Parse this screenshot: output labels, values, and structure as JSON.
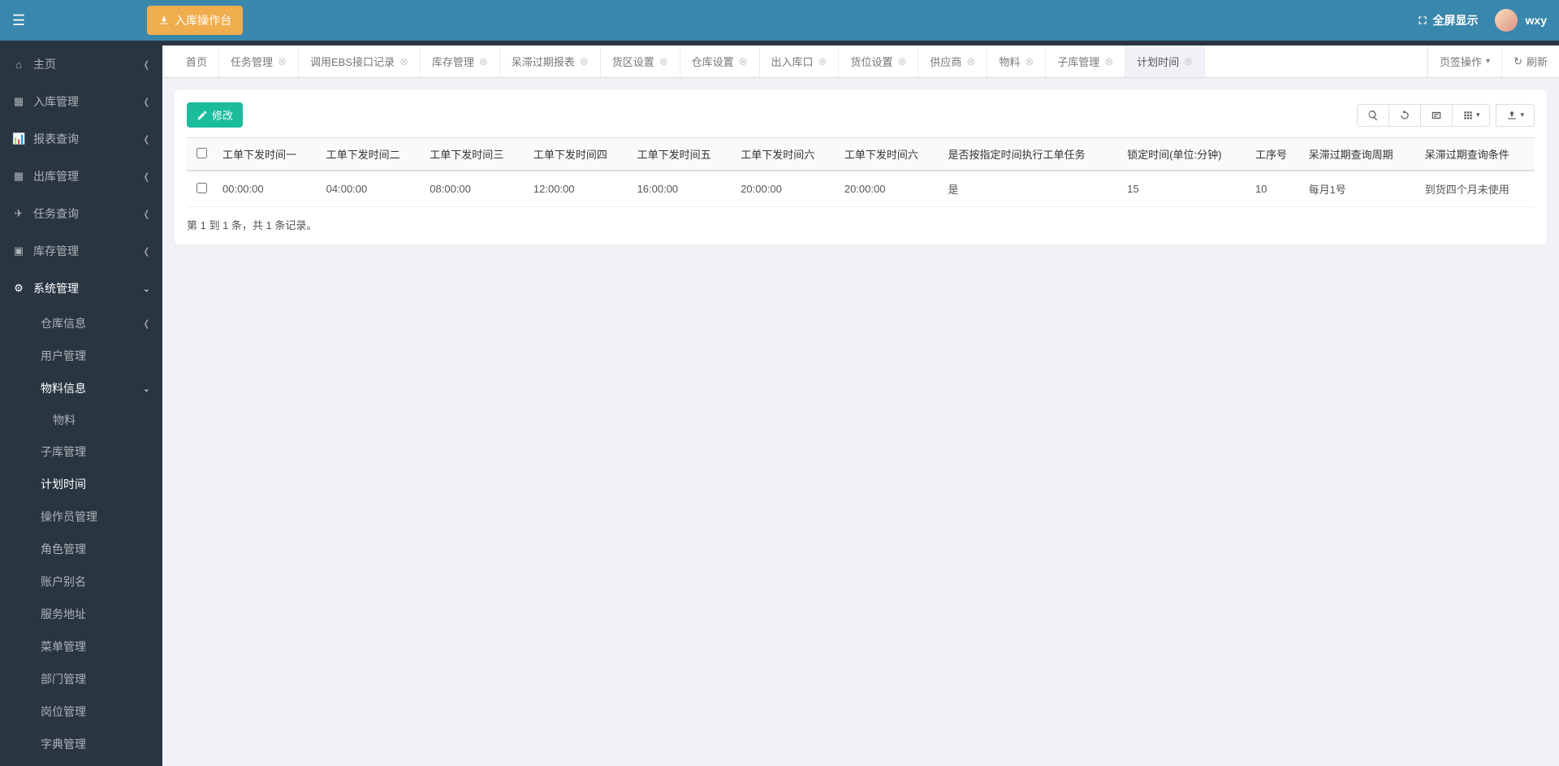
{
  "topbar": {
    "orange_button": "入库操作台",
    "fullscreen": "全屏显示",
    "username": "wxy"
  },
  "sidebar": {
    "home": "主页",
    "inbound": "入库管理",
    "report": "报表查询",
    "outbound": "出库管理",
    "task": "任务查询",
    "stock": "库存管理",
    "system": "系统管理",
    "sub": {
      "warehouse_info": "仓库信息",
      "user_mgmt": "用户管理",
      "material_info": "物料信息",
      "material": "物料",
      "subwarehouse": "子库管理",
      "schedule": "计划时间",
      "operator": "操作员管理",
      "role": "角色管理",
      "account_alias": "账户别名",
      "service_addr": "服务地址",
      "menu_mgmt": "菜单管理",
      "dept_mgmt": "部门管理",
      "position_mgmt": "岗位管理",
      "dict_mgmt": "字典管理"
    }
  },
  "tabs": [
    {
      "label": "首页",
      "closable": false
    },
    {
      "label": "任务管理",
      "closable": true
    },
    {
      "label": "调用EBS接口记录",
      "closable": true
    },
    {
      "label": "库存管理",
      "closable": true
    },
    {
      "label": "呆滞过期报表",
      "closable": true
    },
    {
      "label": "货区设置",
      "closable": true
    },
    {
      "label": "仓库设置",
      "closable": true
    },
    {
      "label": "出入库口",
      "closable": true
    },
    {
      "label": "货位设置",
      "closable": true
    },
    {
      "label": "供应商",
      "closable": true
    },
    {
      "label": "物料",
      "closable": true
    },
    {
      "label": "子库管理",
      "closable": true
    },
    {
      "label": "计划时间",
      "closable": true,
      "active": true
    }
  ],
  "tab_actions": {
    "tab_ops": "页签操作",
    "refresh": "刷新"
  },
  "toolbar": {
    "edit": "修改"
  },
  "table": {
    "headers": [
      "工单下发时间一",
      "工单下发时间二",
      "工单下发时间三",
      "工单下发时间四",
      "工单下发时间五",
      "工单下发时间六",
      "工单下发时间六",
      "是否按指定时间执行工单任务",
      "锁定时间(单位:分钟)",
      "工序号",
      "呆滞过期查询周期",
      "呆滞过期查询条件"
    ],
    "rows": [
      [
        "00:00:00",
        "04:00:00",
        "08:00:00",
        "12:00:00",
        "16:00:00",
        "20:00:00",
        "20:00:00",
        "是",
        "15",
        "10",
        "每月1号",
        "到货四个月未使用"
      ]
    ]
  },
  "pagination": {
    "info": "第 1 到 1 条，共 1 条记录。"
  }
}
